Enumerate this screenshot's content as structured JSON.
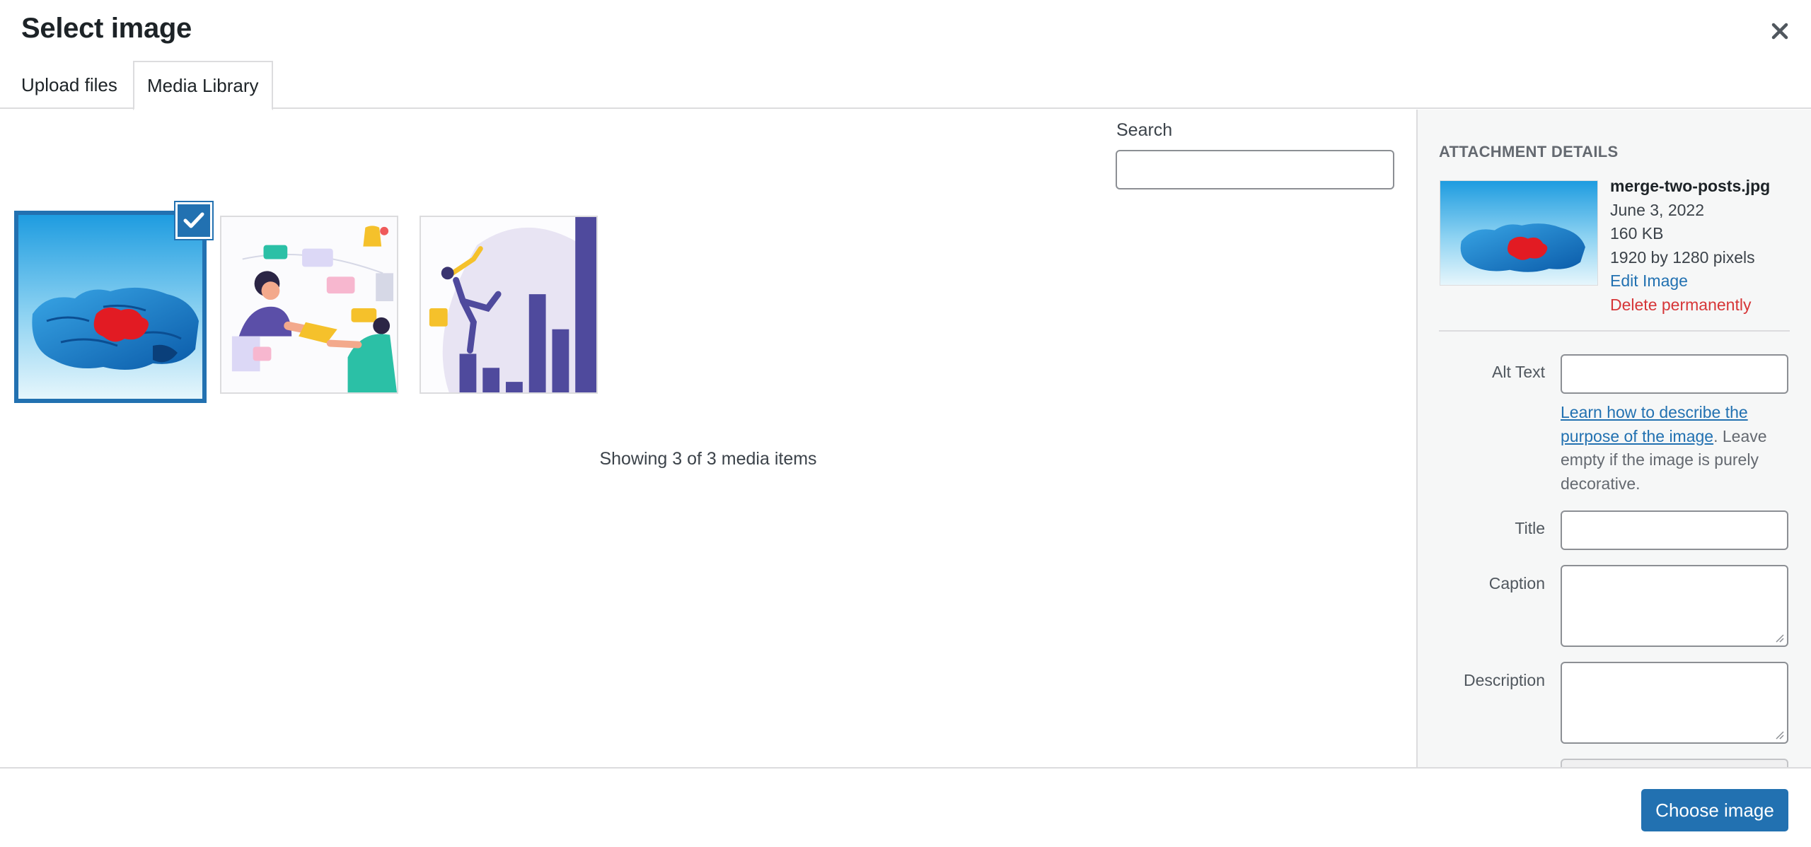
{
  "modal": {
    "title": "Select image",
    "close_label": "Close dialog"
  },
  "tabs": [
    {
      "label": "Upload files",
      "active": false
    },
    {
      "label": "Media Library",
      "active": true
    }
  ],
  "search": {
    "label": "Search",
    "value": "",
    "placeholder": ""
  },
  "media": {
    "items": [
      {
        "subject": "blue jigsaw puzzle with red piece",
        "selected": true
      },
      {
        "subject": "people exchanging envelope with chat bubbles",
        "selected": false
      },
      {
        "subject": "person climbing bar chart",
        "selected": false
      }
    ],
    "status": "Showing 3 of 3 media items"
  },
  "attachment": {
    "heading": "Attachment Details",
    "filename": "merge-two-posts.jpg",
    "date": "June 3, 2022",
    "size": "160 KB",
    "dimensions": "1920 by 1280 pixels",
    "edit_label": "Edit Image",
    "delete_label": "Delete permanently",
    "fields": {
      "alt_text": {
        "label": "Alt Text",
        "value": ""
      },
      "alt_help_link": "Learn how to describe the purpose of the image",
      "alt_help_rest": ". Leave empty if the image is purely decorative.",
      "title": {
        "label": "Title",
        "value": ""
      },
      "caption": {
        "label": "Caption",
        "value": ""
      },
      "description": {
        "label": "Description",
        "value": ""
      }
    }
  },
  "footer": {
    "choose_label": "Choose image"
  },
  "colors": {
    "accent": "#2271b1",
    "danger": "#d63638",
    "sidebar_bg": "#f6f7f7"
  }
}
